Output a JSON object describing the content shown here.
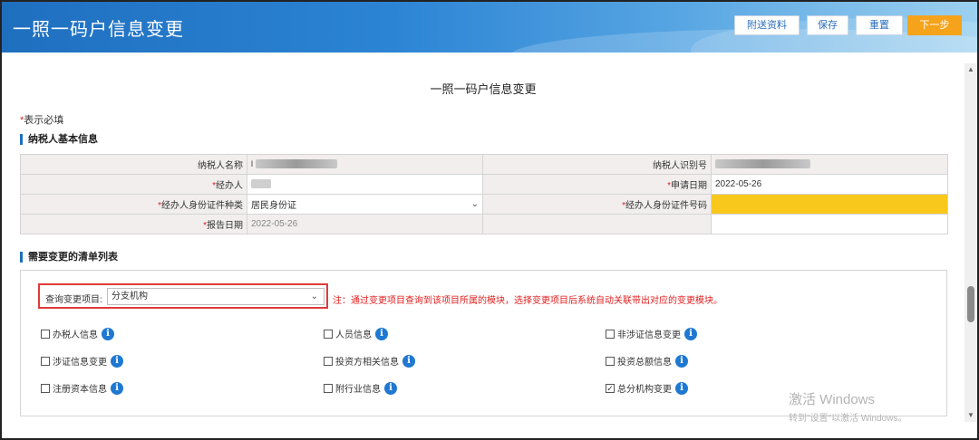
{
  "header": {
    "title": "一照一码户信息变更",
    "buttons": {
      "attach": "附送资料",
      "save": "保存",
      "reset": "重置",
      "next": "下一步"
    }
  },
  "page": {
    "heading": "一照一码户信息变更",
    "required_star": "*",
    "required_text": "表示必填"
  },
  "basic_info": {
    "title": "纳税人基本信息",
    "taxpayer_name_label": "纳税人名称",
    "taxpayer_name_value": "",
    "taxpayer_id_label": "纳税人识别号",
    "taxpayer_id_value": "",
    "agent_label": "经办人",
    "agent_value": "",
    "apply_date_label": "申请日期",
    "apply_date_value": "2022-05-26",
    "id_type_label": "经办人身份证件种类",
    "id_type_value": "居民身份证",
    "id_number_label": "经办人身份证件号码",
    "id_number_value": "",
    "report_date_label": "报告日期",
    "report_date_value": "2022-05-26",
    "highlight_color": "#f8c81c"
  },
  "change_list": {
    "title": "需要变更的清单列表",
    "query_label": "查询变更项目:",
    "query_value": "分支机构",
    "note": "注：通过变更项目查询到该项目所属的模块，选择变更项目后系统自动关联带出对应的变更模块。",
    "options": [
      {
        "label": "办税人信息",
        "checked": false
      },
      {
        "label": "人员信息",
        "checked": false
      },
      {
        "label": "非涉证信息变更",
        "checked": false
      },
      {
        "label": "涉证信息变更",
        "checked": false
      },
      {
        "label": "投资方相关信息",
        "checked": false
      },
      {
        "label": "投资总额信息",
        "checked": false
      },
      {
        "label": "注册资本信息",
        "checked": false
      },
      {
        "label": "附行业信息",
        "checked": false
      },
      {
        "label": "总分机构变更",
        "checked": true
      }
    ]
  },
  "watermark": {
    "line1": "激活 Windows",
    "line2": "转到\"设置\"以激活 Windows。"
  },
  "colors": {
    "header_start": "#1f6fbf",
    "next_button": "#f5a31a",
    "required": "#e02020",
    "info_icon": "#1f78d1"
  }
}
